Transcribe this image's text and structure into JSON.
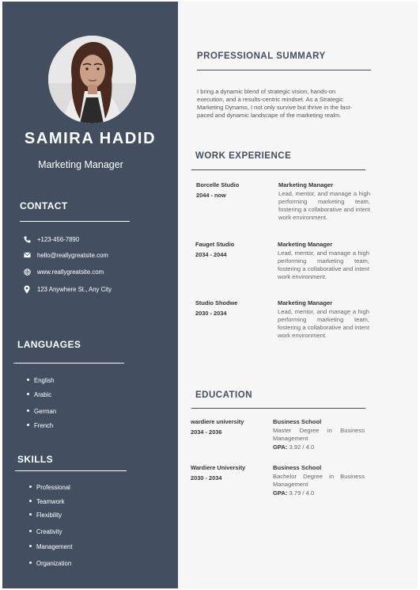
{
  "profile": {
    "name": "SAMIRA HADID",
    "role": "Marketing Manager"
  },
  "contact": {
    "title": "CONTACT",
    "phone": "+123-456-7890",
    "email": "hello@reallygreatsite.com",
    "website": "www.reallygreatsite.com",
    "address": "123 Anywhere St., Any City"
  },
  "languages": {
    "title": "LANGUAGES",
    "items": [
      "English",
      "Arabic",
      "German",
      "French"
    ]
  },
  "skills": {
    "title": "SKILLS",
    "items": [
      "Professional",
      "Teamwork",
      "Flexibility",
      "Creativity",
      "Management",
      "Organization"
    ]
  },
  "summary": {
    "title": "PROFESSIONAL SUMMARY",
    "text": "I bring a dynamic blend of strategic vision, hands-on execution, and a results-centric mindset. As a Strategic Marketing Dynamo, I not only survive but thrive in the fast-paced and dynamic landscape of the marketing realm."
  },
  "experience": {
    "title": "WORK EXPERIENCE",
    "items": [
      {
        "org": "Borcelle Studio",
        "dates": "2044 - now",
        "title": "Marketing Manager",
        "desc": "Lead, mentor, and manage a high performing marketing team, fostering a collaborative and intent work environment."
      },
      {
        "org": "Fauget Studio",
        "dates": "2034 - 2044",
        "title": "Marketing Manager",
        "desc": "Lead, mentor, and manage a high performing marketing team, fostering a collaborative and intent work environment."
      },
      {
        "org": "Studio Shodwe",
        "dates": "2030 - 2034",
        "title": "Marketing Manager",
        "desc": "Lead, mentor, and manage a high performing marketing team, fostering a collaborative and intent work environment."
      }
    ]
  },
  "education": {
    "title": "EDUCATION",
    "items": [
      {
        "school": "wardiere university",
        "dates": "2034 - 2036",
        "title": "Business School",
        "degree": "Master Degree in Business Management",
        "gpa_label": "GPA:",
        "gpa_value": "3.92 / 4.0"
      },
      {
        "school": "Wardiere University",
        "dates": "2030 - 2034",
        "title": "Business School",
        "degree": "Bachelor Degree in Business Management",
        "gpa_label": "GPA:",
        "gpa_value": "3.79 / 4.0"
      }
    ]
  },
  "colors": {
    "sidebar": "#434f61",
    "main_bg": "#f6f6f6",
    "accent_text": "#434f61"
  },
  "icons": {
    "phone": "phone-icon",
    "email": "email-icon",
    "website": "globe-icon",
    "address": "location-pin-icon"
  }
}
